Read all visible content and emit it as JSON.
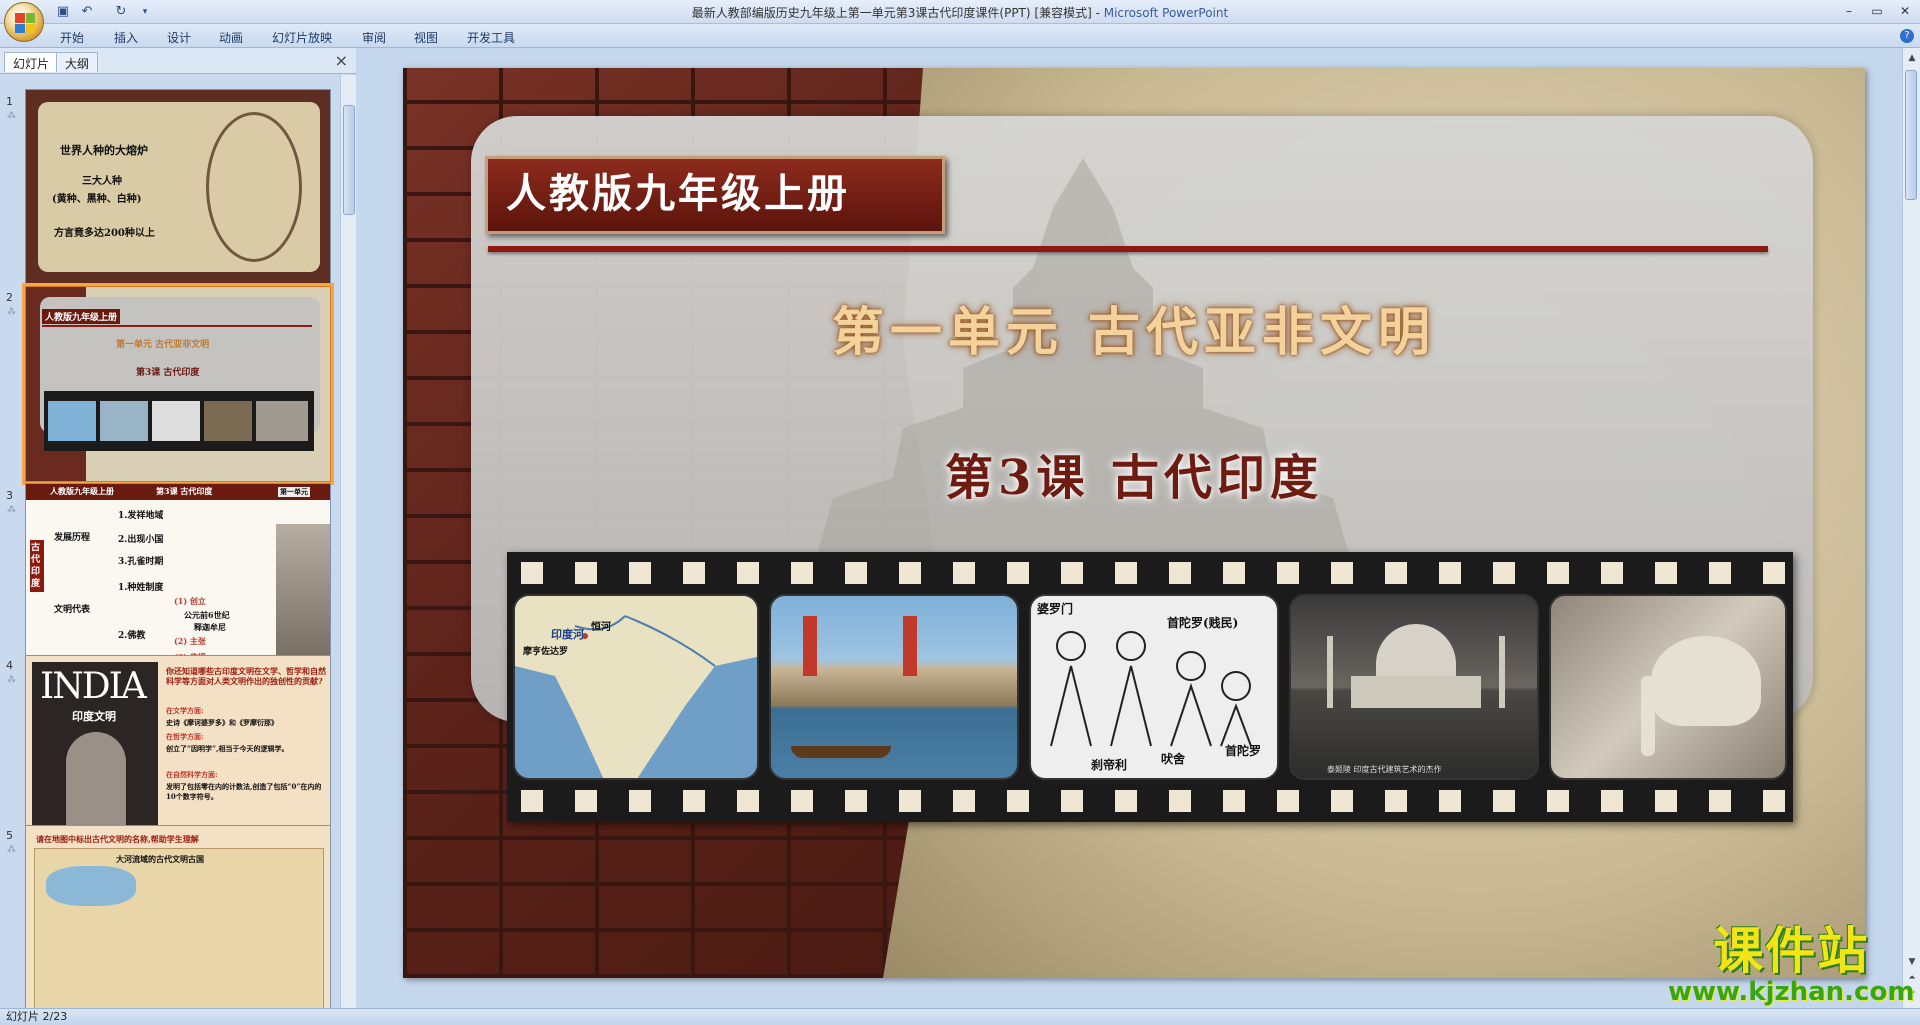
{
  "window": {
    "title": "最新人教部编版历史九年级上第一单元第3课古代印度课件(PPT) [兼容模式]",
    "app_name": "Microsoft PowerPoint",
    "title_sep": " - "
  },
  "ribbon": {
    "tabs": [
      "开始",
      "插入",
      "设计",
      "动画",
      "幻灯片放映",
      "审阅",
      "视图",
      "开发工具"
    ]
  },
  "left_pane": {
    "tabs": [
      "幻灯片",
      "大纲"
    ],
    "close": "×"
  },
  "thumbnails": [
    {
      "num": "1",
      "lines": [
        "世界人种的大熔炉",
        "三大人种",
        "(黄种、黑种、白种)",
        "方言竟多达200种以上"
      ]
    },
    {
      "num": "2",
      "lines": [
        "人教版九年级上册",
        "第一单元 古代亚非文明",
        "第3课 古代印度"
      ]
    },
    {
      "num": "3",
      "lines": [
        "人教版九年级上册",
        "第3课 古代印度",
        "第一单元",
        "古代印度",
        "发展历程",
        "1.发祥地域",
        "2.出现小国",
        "3.孔雀时期",
        "文明代表",
        "1.种姓制度",
        "2.佛教",
        "(1) 创立",
        "公元前6世纪",
        "释迦牟尼",
        "(2) 主张",
        "(3) 传播"
      ]
    },
    {
      "num": "4",
      "lines": [
        "INDIA",
        "印度文明",
        "你还知道哪些古印度文明在文学、哲学和自然科学等方面对人类文明作出的独创性的贡献?",
        "在文学方面:",
        "史诗《摩诃婆罗多》和《罗摩衍那》",
        "在哲学方面:",
        "创立了“因明学”,相当于今天的逻辑学。",
        "在自然科学方面:",
        "发明了包括零在内的计数法,创造了包括“0”在内的10个数字符号。"
      ]
    },
    {
      "num": "5",
      "lines": [
        "请在地图中标出古代文明的名称,帮助学生理解",
        "大河流域的古代文明古国"
      ]
    }
  ],
  "slide": {
    "tag": "人教版九年级上册",
    "unit": "第一单元 古代亚非文明",
    "lesson": "第3课 古代印度",
    "film_labels": {
      "map1": "印度河",
      "map2": "恒河",
      "map3": "摩亨佐达罗",
      "caste1": "婆罗门",
      "caste2": "首陀罗(贱民)",
      "caste3": "刹帝利",
      "caste4": "吠舍",
      "caste5": "首陀罗",
      "taj": "泰姬陵 印度古代建筑艺术的杰作"
    }
  },
  "watermark": {
    "line1": "课件站",
    "line2": "www.kjzhan.com"
  },
  "status": {
    "slide_counter": "幻灯片 2/23"
  }
}
